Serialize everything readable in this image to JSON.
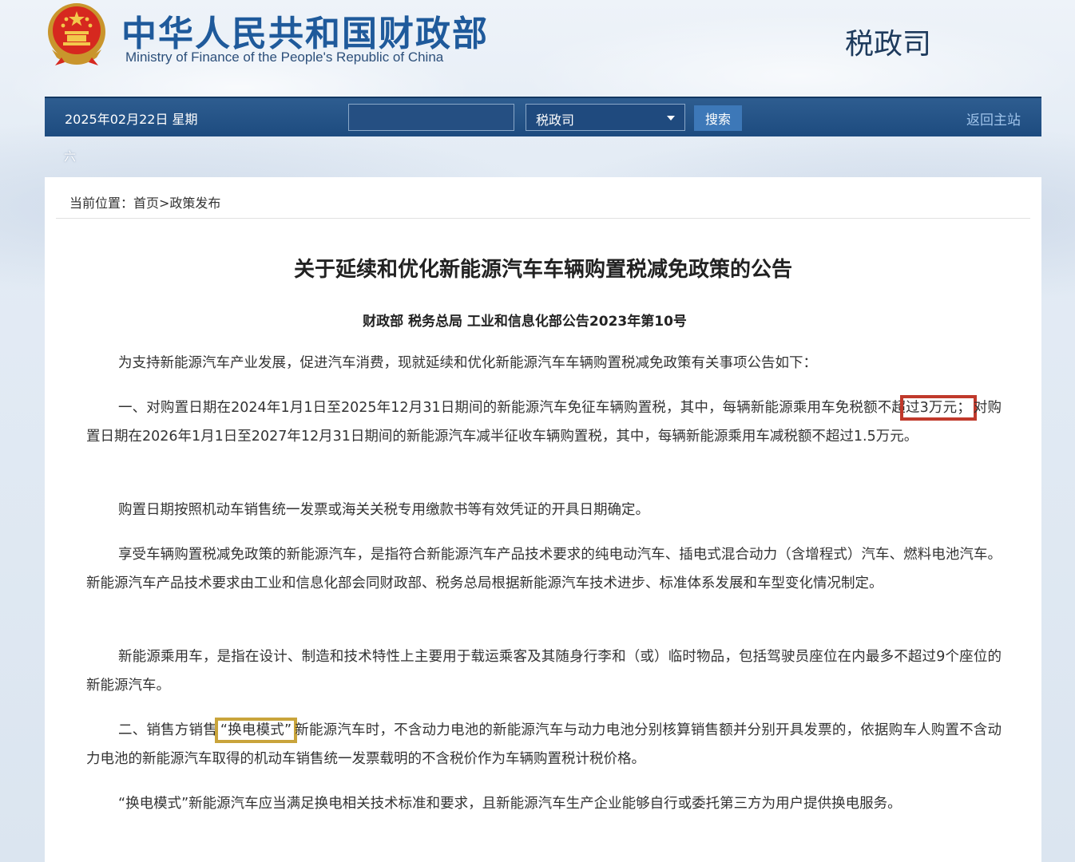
{
  "header": {
    "title_cn": "中华人民共和国财政部",
    "title_en": "Ministry of Finance of the People's Republic of China",
    "department": "税政司"
  },
  "navbar": {
    "date": "2025年02月22日  星期",
    "search_placeholder": "",
    "select_value": "税政司",
    "search_button": "搜索",
    "home_link": "返回主站",
    "overflow_char": "六"
  },
  "breadcrumb": "当前位置：首页>政策发布",
  "document": {
    "title": "关于延续和优化新能源汽车车辆购置税减免政策的公告",
    "subtitle": "财政部 税务总局 工业和信息化部公告2023年第10号",
    "intro": "为支持新能源汽车产业发展，促进汽车消费，现就延续和优化新能源汽车车辆购置税减免政策有关事项公告如下：",
    "item1_before": "一、对购置日期在2024年1月1日至2025年12月31日期间的新能源汽车免征车辆购置税，其中，每辆新能源乘用车免税额不超",
    "item1_highlight": "过3万元；",
    "item1_after": "对购置日期在2026年1月1日至2027年12月31日期间的新能源汽车减半征收车辆购置税，其中，每辆新能源乘用车减税额不超过1.5万元。",
    "para_date": "购置日期按照机动车销售统一发票或海关关税专用缴款书等有效凭证的开具日期确定。",
    "para_definition": "享受车辆购置税减免政策的新能源汽车，是指符合新能源汽车产品技术要求的纯电动汽车、插电式混合动力（含增程式）汽车、燃料电池汽车。新能源汽车产品技术要求由工业和信息化部会同财政部、税务总局根据新能源汽车技术进步、标准体系发展和车型变化情况制定。",
    "para_passenger": "新能源乘用车，是指在设计、制造和技术特性上主要用于载运乘客及其随身行李和（或）临时物品，包括驾驶员座位在内最多不超过9个座位的新能源汽车。",
    "item2_before": "二、销售方销售",
    "item2_highlight": "“换电模式”",
    "item2_after": "新能源汽车时，不含动力电池的新能源汽车与动力电池分别核算销售额并分别开具发票的，依据购车人购置不含动力电池的新能源汽车取得的机动车销售统一发票载明的不含税价作为车辆购置税计税价格。",
    "para_swap": "“换电模式”新能源汽车应当满足换电相关技术标准和要求，且新能源汽车生产企业能够自行或委托第三方为用户提供换电服务。"
  },
  "colors": {
    "brand_blue": "#1f5a9b",
    "navbar_bg": "#1d4b7f",
    "highlight_red": "#c0392b",
    "highlight_gold": "#c9a43b"
  }
}
